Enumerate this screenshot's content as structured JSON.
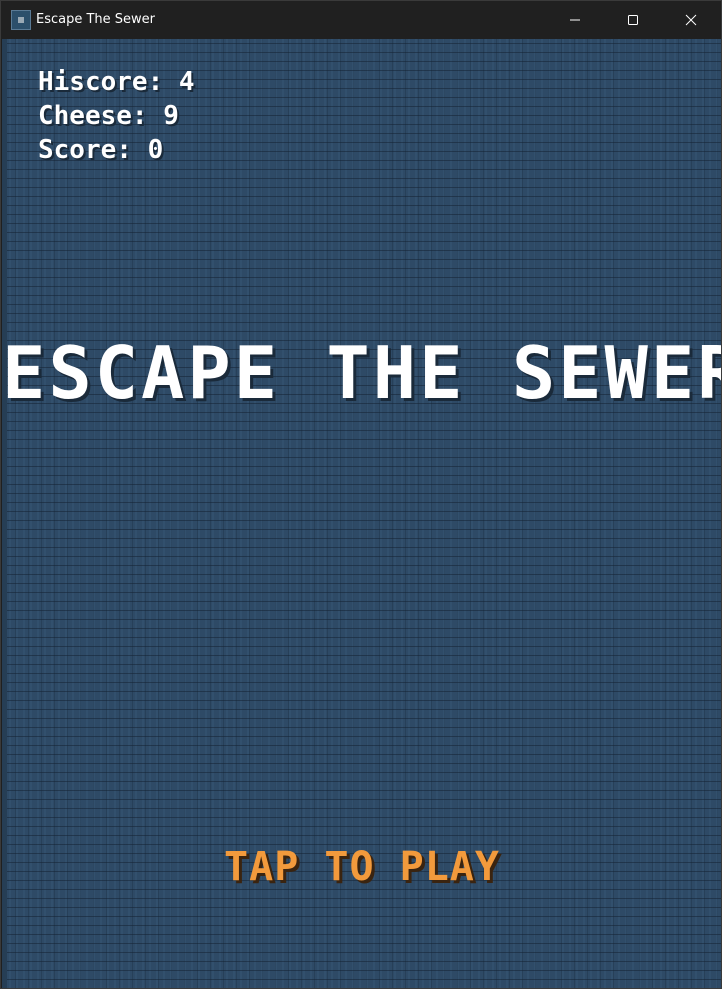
{
  "window": {
    "title": "Escape The Sewer",
    "icon": "app-icon",
    "controls": [
      "minimize-icon",
      "maximize-icon",
      "close-icon"
    ]
  },
  "hud": {
    "hiscore": "Hiscore: 4",
    "cheese": "Cheese: 9",
    "score": "Score: 0"
  },
  "game": {
    "title": "ESCAPE THE SEWER",
    "prompt": "TAP TO PLAY"
  },
  "colors": {
    "background": "#2e4a66",
    "title": "#ffffff",
    "prompt": "#f29a3c"
  }
}
